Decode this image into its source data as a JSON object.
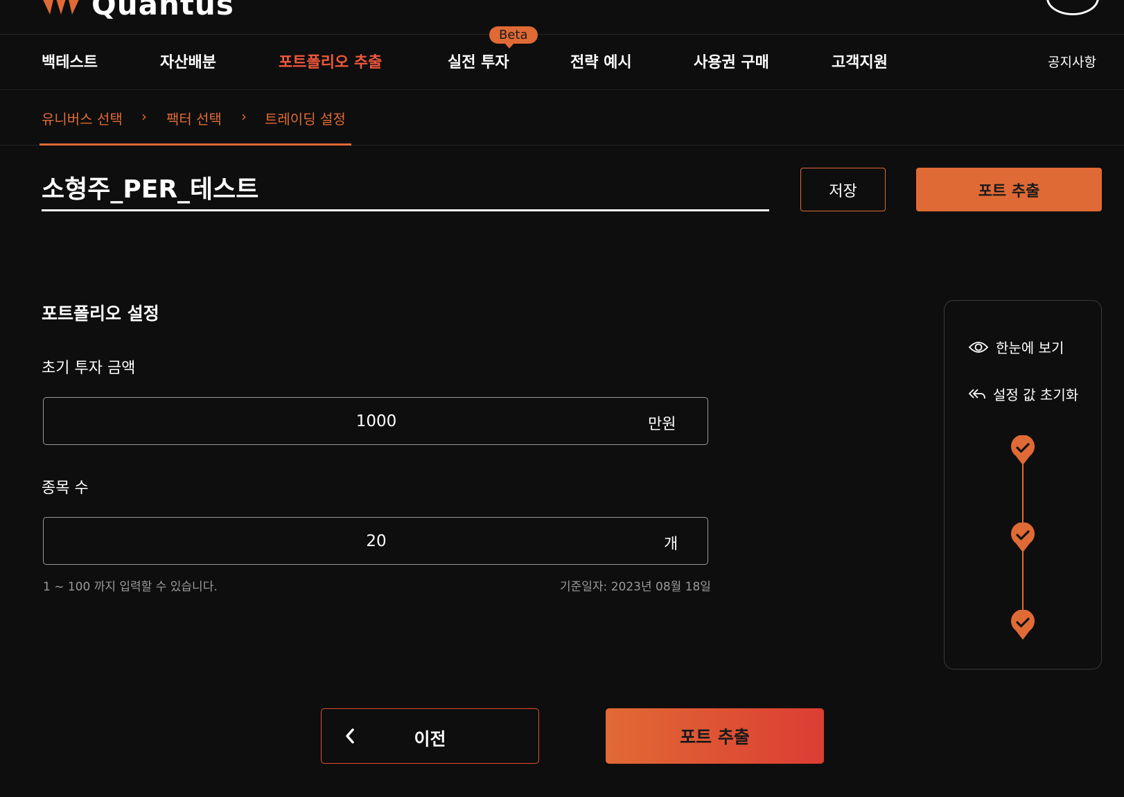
{
  "brand": {
    "logo_text": "Quantus"
  },
  "nav": {
    "items": [
      "백테스트",
      "자산배분",
      "포트폴리오 추출",
      "실전 투자",
      "전략 예시",
      "사용권 구매",
      "고객지원"
    ],
    "beta_badge": "Beta",
    "notice": "공지사항"
  },
  "steps": [
    "유니버스 선택",
    "팩터 선택",
    "트레이딩 설정"
  ],
  "strategy": {
    "title": "소형주_PER_테스트"
  },
  "toolbar": {
    "save_label": "저장",
    "extract_label": "포트 추출"
  },
  "portfolio": {
    "section_title": "포트폴리오 설정",
    "initial_amount_label": "초기 투자 금액",
    "initial_amount_value": "1000",
    "initial_amount_unit": "만원",
    "stock_count_label": "종목 수",
    "stock_count_value": "20",
    "stock_count_unit": "개",
    "hint": "1 ~ 100 까지 입력할 수 있습니다.",
    "base_date": "기준일자: 2023년 08월 18일"
  },
  "side_panel": {
    "overview": "한눈에 보기",
    "reset": "설정 값 초기화",
    "completed_steps": 3
  },
  "footer": {
    "prev_label": "이전",
    "extract_label": "포트 추출"
  },
  "colors": {
    "accent": "#e06a35",
    "accent_red": "#dc3d33",
    "background": "#0e0e0e",
    "active_nav": "#f0583c"
  }
}
